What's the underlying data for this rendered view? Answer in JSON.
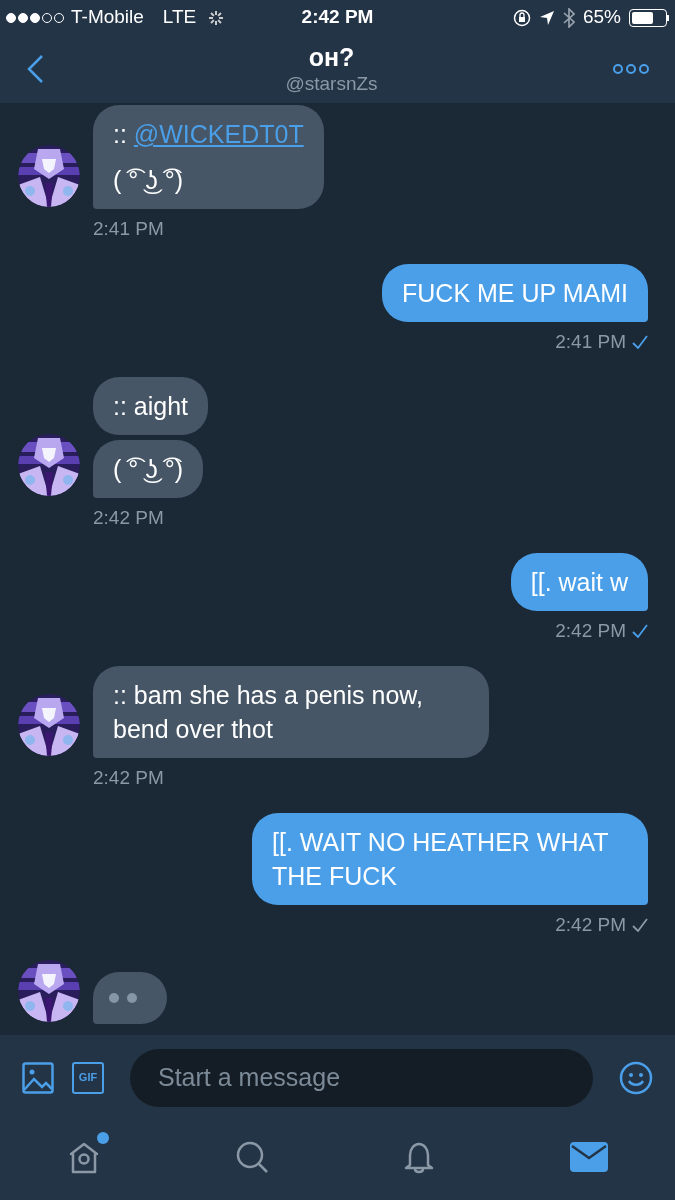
{
  "status_bar": {
    "carrier": "T-Mobile",
    "network": "LTE",
    "time": "2:42 PM",
    "battery": "65%"
  },
  "header": {
    "title": "ᴏʜ?",
    "handle": "@starsnZs"
  },
  "messages": [
    {
      "kind": "incoming",
      "bubbles": [
        {
          "kind": "text",
          "paragraphs": [
            {
              "text": ":: ",
              "link": "@WICKEDT0T"
            },
            {
              "text": "( ͡° ͜ʖ ͡°)"
            }
          ]
        }
      ],
      "time": "2:41 PM"
    },
    {
      "kind": "outgoing",
      "bubbles": [
        {
          "kind": "text",
          "paragraphs": [
            {
              "text": "FUCK ME UP MAMI"
            }
          ]
        }
      ],
      "time": "2:41 PM",
      "read": true
    },
    {
      "kind": "incoming",
      "bubbles": [
        {
          "kind": "text",
          "paragraphs": [
            {
              "text": ":: aight"
            }
          ]
        },
        {
          "kind": "text",
          "paragraphs": [
            {
              "text": "( ͡° ͜ʖ ͡°)"
            }
          ]
        }
      ],
      "time": "2:42 PM"
    },
    {
      "kind": "outgoing",
      "bubbles": [
        {
          "kind": "text",
          "paragraphs": [
            {
              "text": "[[. wait w"
            }
          ]
        }
      ],
      "time": "2:42 PM",
      "read": true
    },
    {
      "kind": "incoming",
      "bubbles": [
        {
          "kind": "text",
          "paragraphs": [
            {
              "text": ":: bam she has a penis now, bend over thot"
            }
          ]
        }
      ],
      "time": "2:42 PM"
    },
    {
      "kind": "outgoing",
      "bubbles": [
        {
          "kind": "text",
          "paragraphs": [
            {
              "text": "[[. WAIT NO HEATHER WHAT THE FUCK"
            }
          ]
        }
      ],
      "time": "2:42 PM",
      "read": false
    },
    {
      "kind": "incoming",
      "bubbles": [
        {
          "kind": "typing"
        }
      ]
    }
  ],
  "composer": {
    "placeholder": "Start a message",
    "gif_label": "GIF"
  },
  "tabs": [
    {
      "kind": "home",
      "selected": false,
      "badge": true
    },
    {
      "kind": "search",
      "selected": false,
      "badge": false
    },
    {
      "kind": "notifications",
      "selected": false,
      "badge": false
    },
    {
      "kind": "messages",
      "selected": true,
      "badge": false
    }
  ]
}
